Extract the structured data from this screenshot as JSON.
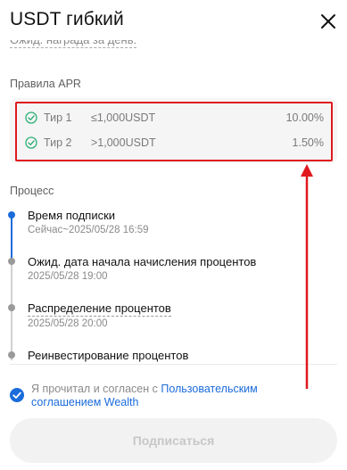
{
  "header": {
    "title": "USDT гибкий"
  },
  "cut_line": {
    "text": "Ожид. награда за день:"
  },
  "apr": {
    "label": "Правила APR",
    "tiers": [
      {
        "name": "Тир 1",
        "range": "≤1,000USDT",
        "rate": "10.00%"
      },
      {
        "name": "Тир 2",
        "range": ">1,000USDT",
        "rate": "1.50%"
      }
    ]
  },
  "process": {
    "label": "Процесс",
    "steps": [
      {
        "title": "Время подписки",
        "sub": "Сейчас~2025/05/28 16:59"
      },
      {
        "title": "Ожид. дата начала начисления процентов",
        "sub": "2025/05/28 19:00"
      },
      {
        "title": "Распределение процентов",
        "sub": "2025/05/28 20:00"
      },
      {
        "title": "Реинвестирование процентов",
        "sub": ""
      }
    ]
  },
  "agreement": {
    "text": "Я прочитал и согласен с",
    "link": "Пользовательским соглашением Wealth",
    "checked": true
  },
  "submit": {
    "label": "Подписаться"
  },
  "colors": {
    "accent": "#1a6bdb",
    "check_green": "#2eae78",
    "annotation_red": "#e0191f"
  },
  "icons": [
    "close-icon",
    "check-circle-icon",
    "checkmark-icon"
  ]
}
